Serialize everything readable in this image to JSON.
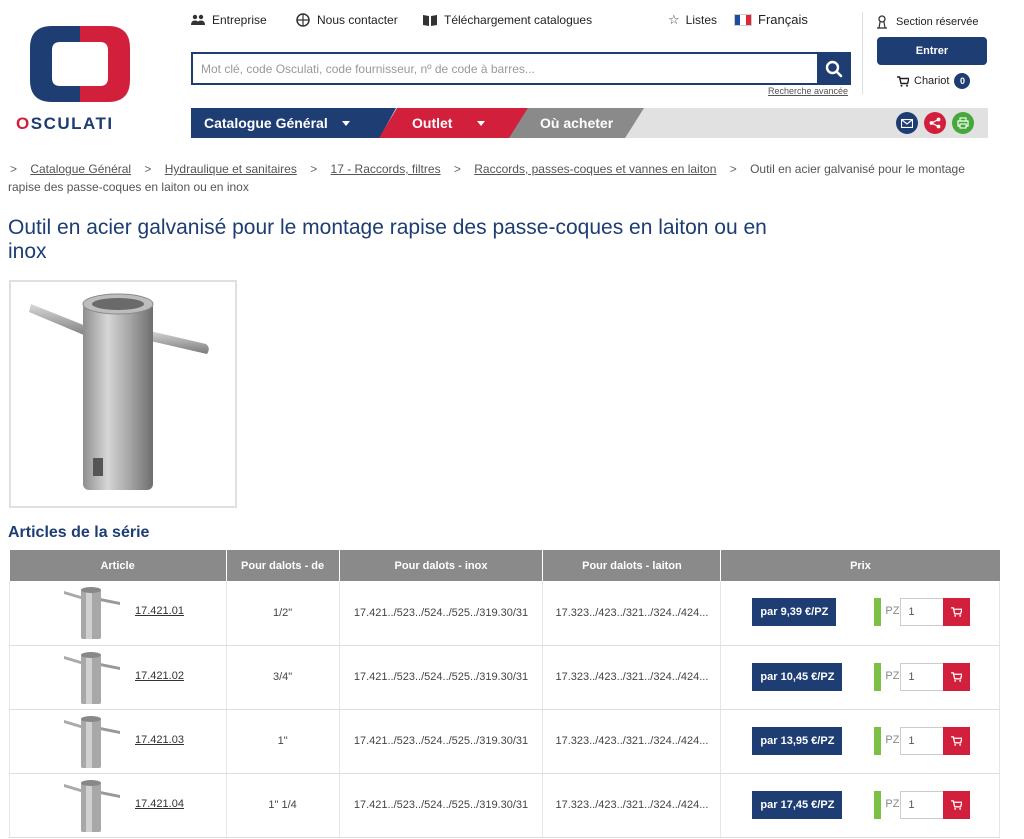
{
  "brand": {
    "name_part1": "O",
    "name_part2": "SCULATI"
  },
  "top_links": {
    "company": "Entreprise",
    "contact": "Nous contacter",
    "catalogs": "Téléchargement catalogues",
    "lists": "Listes",
    "language": "Français"
  },
  "search": {
    "placeholder": "Mot clé, code Osculati, code fournisseur, nº de code à barres...",
    "advanced": "Recherche avancée"
  },
  "account": {
    "reserved_label": "Section réservée",
    "login_label": "Entrer",
    "cart_label": "Chariot",
    "cart_count": "0"
  },
  "nav": {
    "catalog": "Catalogue Général",
    "outlet": "Outlet",
    "where_to_buy": "Où acheter"
  },
  "breadcrumb": {
    "items": [
      "Catalogue Général",
      "Hydraulique et sanitaires",
      "17 - Raccords, filtres",
      "Raccords, passes-coques et vannes en laiton"
    ],
    "current": "Outil en acier galvanisé pour le montage rapise des passe-coques en laiton ou en inox"
  },
  "product": {
    "title": "Outil en acier galvanisé pour le montage rapise des passe-coques en laiton ou en inox"
  },
  "series": {
    "title": "Articles de la série",
    "headers": [
      "Article",
      "Pour dalots - de",
      "Pour dalots - inox",
      "Pour dalots - laiton",
      "Prix"
    ],
    "rows": [
      {
        "code": "17.421.01",
        "size": "1/2\"",
        "inox": "17.421../523../524../525../319.30/31",
        "laiton": "17.323../423../321../324../424...",
        "price": "par 9,39 €/PZ",
        "unit": "PZ",
        "qty": "1"
      },
      {
        "code": "17.421.02",
        "size": "3/4\"",
        "inox": "17.421../523../524../525../319.30/31",
        "laiton": "17.323../423../321../324../424...",
        "price": "par 10,45 €/PZ",
        "unit": "PZ",
        "qty": "1"
      },
      {
        "code": "17.421.03",
        "size": "1\"",
        "inox": "17.421../523../524../525../319.30/31",
        "laiton": "17.323../423../321../324../424...",
        "price": "par 13,95 €/PZ",
        "unit": "PZ",
        "qty": "1"
      },
      {
        "code": "17.421.04",
        "size": "1\" 1/4",
        "inox": "17.421../523../524../525../319.30/31",
        "laiton": "17.323../423../321../324../424...",
        "price": "par 17,45 €/PZ",
        "unit": "PZ",
        "qty": "1"
      }
    ]
  },
  "colors": {
    "brand_blue": "#1d3d73",
    "brand_red": "#d21f3c",
    "nav_gray": "#8a8a8a",
    "stock_green": "#7cbf45"
  }
}
